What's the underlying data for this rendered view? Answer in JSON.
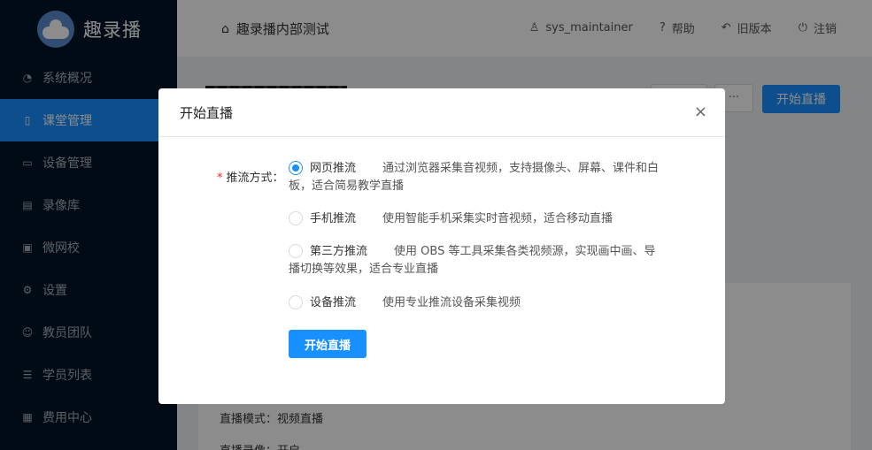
{
  "app": {
    "name": "趣录播"
  },
  "sidebar": {
    "items": [
      {
        "label": "系统概况",
        "icon": "dashboard-icon",
        "active": false
      },
      {
        "label": "课堂管理",
        "icon": "book-icon",
        "active": true
      },
      {
        "label": "设备管理",
        "icon": "camera-icon",
        "active": false
      },
      {
        "label": "录像库",
        "icon": "file-icon",
        "active": false
      },
      {
        "label": "微网校",
        "icon": "school-icon",
        "active": false
      },
      {
        "label": "设置",
        "icon": "gear-icon",
        "active": false
      },
      {
        "label": "教员团队",
        "icon": "team-icon",
        "active": false
      },
      {
        "label": "学员列表",
        "icon": "list-icon",
        "active": false
      },
      {
        "label": "费用中心",
        "icon": "bill-icon",
        "active": false
      }
    ]
  },
  "header": {
    "title": "趣录播内部测试",
    "user": "sys_maintainer",
    "help": "帮助",
    "old_version": "旧版本",
    "logout": "注销"
  },
  "content": {
    "more_label": "···",
    "start_live_label": "开始直播",
    "detail_mode": "直播模式：视频直播",
    "detail_record": "直播录像：开启"
  },
  "modal": {
    "title": "开始直播",
    "close": "×",
    "field_label": "推流方式：",
    "required_mark": "*",
    "options": [
      {
        "title": "网页推流",
        "desc": "通过浏览器采集音视频，支持摄像头、屏幕、课件和白板，适合简易教学直播",
        "checked": true
      },
      {
        "title": "手机推流",
        "desc": "使用智能手机采集实时音视频，适合移动直播",
        "checked": false
      },
      {
        "title": "第三方推流",
        "desc": "使用 OBS 等工具采集各类视频源，实现画中画、导播切换等效果，适合专业直播",
        "checked": false
      },
      {
        "title": "设备推流",
        "desc": "使用专业推流设备采集视频",
        "checked": false
      }
    ],
    "submit": "开始直播"
  },
  "colors": {
    "sidebar_bg": "#001529",
    "accent": "#1890ff",
    "required": "#f5222d"
  }
}
